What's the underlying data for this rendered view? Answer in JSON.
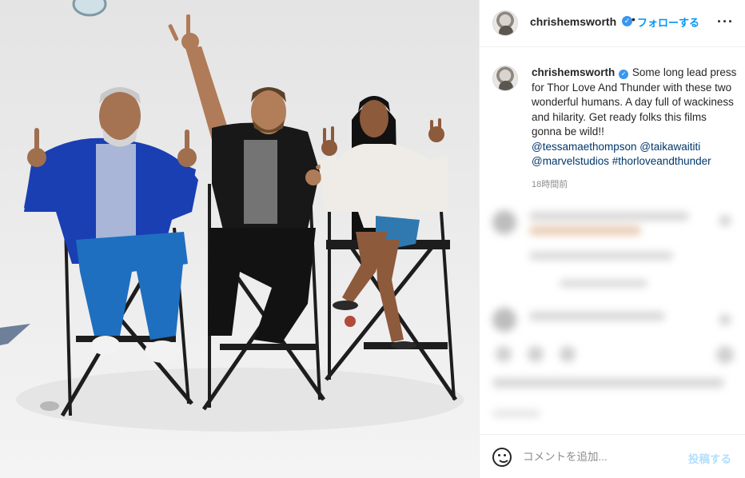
{
  "post": {
    "username": "chrishemsworth",
    "follow_label": "フォローする",
    "more_icon": "more-horizontal-icon",
    "caption_username": "chrishemsworth",
    "caption_text": "Some long lead press for Thor Love And Thunder with these two wonderful humans. A day full of wackiness and hilarity. Get ready folks this films gonna be wild!!",
    "mentions": [
      "@tessamaethompson",
      "@taikawaititi",
      "@marvelstudios"
    ],
    "hashtag": "#thorloveandthunder",
    "time_ago": "18時間前",
    "verified_icon": "verified-badge-icon"
  },
  "composer": {
    "placeholder": "コメントを追加...",
    "post_label": "投稿する",
    "emoji_icon": "emoji-smile-icon"
  },
  "colors": {
    "link": "#00376b",
    "follow": "#0095f6",
    "post_disabled": "#b2dffc",
    "verified": "#3897f0"
  }
}
